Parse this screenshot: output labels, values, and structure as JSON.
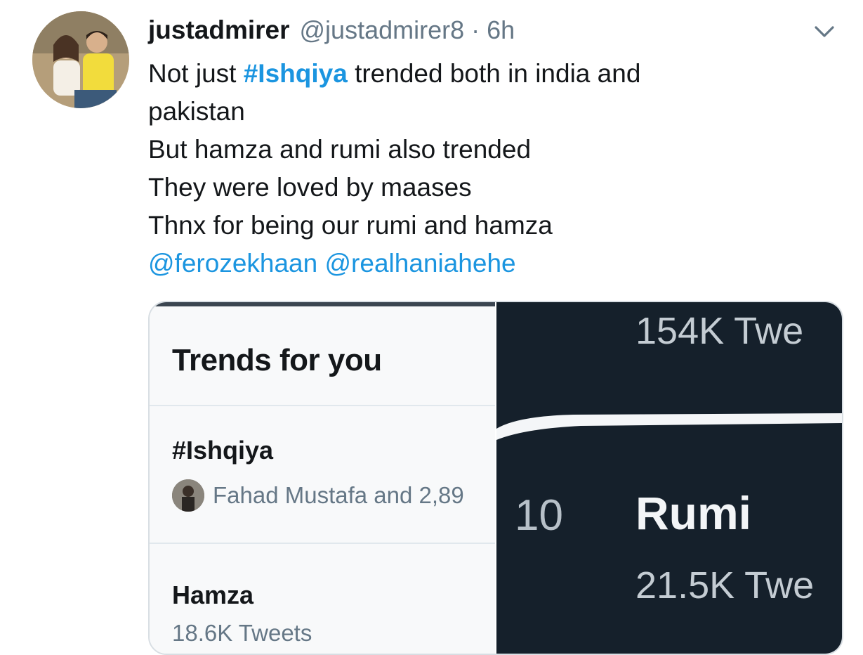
{
  "tweet": {
    "author_name": "justadmirer",
    "author_handle": "@justadmirer8",
    "separator": "·",
    "time": "6h",
    "text_line1_before": "Not just ",
    "text_hashtag": "#Ishqiya",
    "text_line1_after": " trended both in india and",
    "text_line2": "pakistan",
    "text_line3": "But hamza and rumi also trended",
    "text_line4": "They were loved by maases",
    "text_line5": "Thnx for being our rumi and hamza",
    "mention1": "@ferozekhaan",
    "mention2": "@realhaniahehe",
    "menu_icon": "chevron-down-icon"
  },
  "media": {
    "left": {
      "title": "Trends for you",
      "trends": [
        {
          "name": "#Ishqiya",
          "meta": "Fahad Mustafa and 2,89"
        },
        {
          "name": "Hamza",
          "meta": "18.6K Tweets"
        }
      ]
    },
    "right": {
      "count_top": "154K Twe",
      "rank": "10",
      "name": "Rumi",
      "count_bottom": "21.5K Twe"
    }
  },
  "colors": {
    "link": "#1b95e0",
    "secondary_text": "#657786",
    "dark_panel": "#15202b"
  }
}
